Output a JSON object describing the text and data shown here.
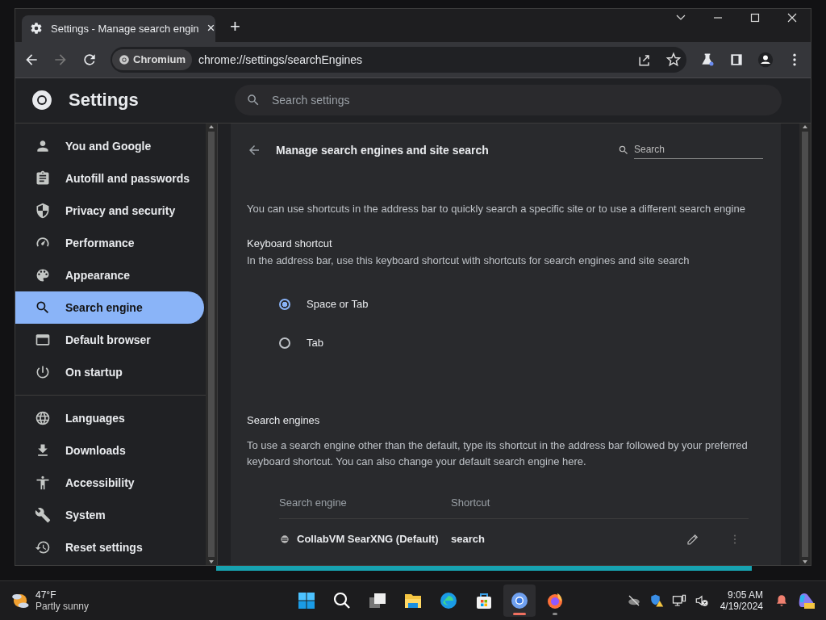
{
  "browser": {
    "tab": {
      "title": "Settings - Manage search engin",
      "close": "×"
    },
    "new_tab": "+",
    "address": {
      "chip": "Chromium",
      "url": "chrome://settings/searchEngines"
    }
  },
  "header": {
    "title": "Settings",
    "search_placeholder": "Search settings"
  },
  "sidebar": {
    "sections": [
      {
        "items": [
          {
            "label": "You and Google",
            "selected": false
          },
          {
            "label": "Autofill and passwords",
            "selected": false
          },
          {
            "label": "Privacy and security",
            "selected": false
          },
          {
            "label": "Performance",
            "selected": false
          },
          {
            "label": "Appearance",
            "selected": false
          },
          {
            "label": "Search engine",
            "selected": true
          },
          {
            "label": "Default browser",
            "selected": false
          },
          {
            "label": "On startup",
            "selected": false
          }
        ]
      },
      {
        "items": [
          {
            "label": "Languages",
            "selected": false
          },
          {
            "label": "Downloads",
            "selected": false
          },
          {
            "label": "Accessibility",
            "selected": false
          },
          {
            "label": "System",
            "selected": false
          },
          {
            "label": "Reset settings",
            "selected": false
          }
        ]
      }
    ]
  },
  "page": {
    "title": "Manage search engines and site search",
    "search_placeholder": "Search",
    "intro": "You can use shortcuts in the address bar to quickly search a specific site or to use a different search engine",
    "keyboard_shortcut": {
      "heading": "Keyboard shortcut",
      "description": "In the address bar, use this keyboard shortcut with shortcuts for search engines and site search",
      "options": [
        {
          "label": "Space or Tab",
          "selected": true
        },
        {
          "label": "Tab",
          "selected": false
        }
      ]
    },
    "search_engines": {
      "heading": "Search engines",
      "description": "To use a search engine other than the default, type its shortcut in the address bar followed by your preferred keyboard shortcut. You can also change your default search engine here.",
      "columns": [
        "Search engine",
        "Shortcut"
      ],
      "rows": [
        {
          "name": "CollabVM SearXNG (Default)",
          "shortcut": "search"
        }
      ]
    }
  },
  "taskbar": {
    "weather": {
      "temperature": "47°F",
      "condition": "Partly sunny"
    },
    "apps": [
      {
        "selected": false,
        "running": false
      },
      {
        "selected": false,
        "running": false
      },
      {
        "selected": false,
        "running": false
      },
      {
        "selected": false,
        "running": false
      },
      {
        "selected": false,
        "running": false
      },
      {
        "selected": false,
        "running": false
      },
      {
        "selected": true,
        "running": true
      },
      {
        "selected": false,
        "running": true
      }
    ],
    "clock": {
      "time": "9:05 AM",
      "date": "4/19/2024"
    }
  }
}
